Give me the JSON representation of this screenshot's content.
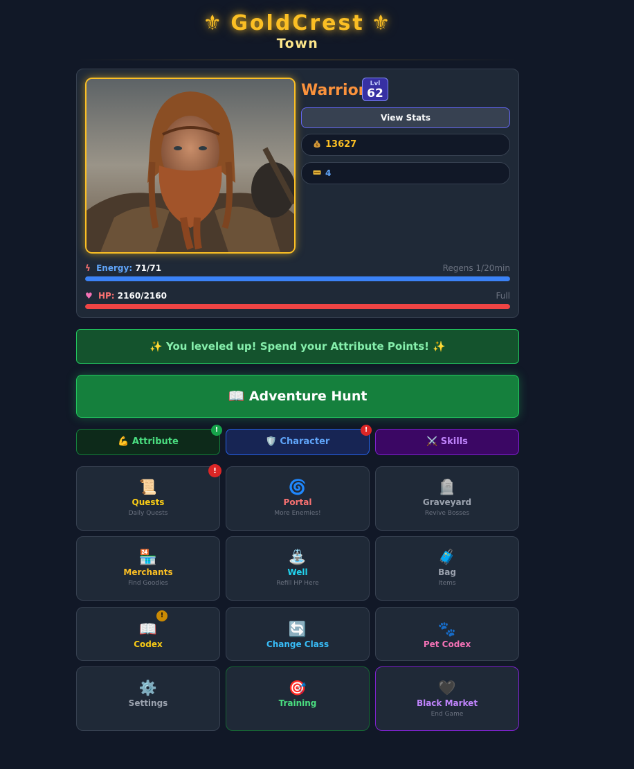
{
  "header": {
    "title": "GoldCrest",
    "fleur": "⚜",
    "subtitle": "Town"
  },
  "character": {
    "class_name": "Warrior",
    "level_label": "Lvl",
    "level": "62",
    "view_stats_label": "View Stats",
    "gold": "13627",
    "tickets": "4",
    "energy": {
      "label": "Energy:",
      "value": "71/71",
      "note": "Regens 1/20min",
      "fill_fraction": 1.0
    },
    "hp": {
      "label": "HP:",
      "value": "2160/2160",
      "note": "Full",
      "fill_fraction": 1.0
    }
  },
  "banner": {
    "level_up": "✨ You leveled up! Spend your Attribute Points! ✨"
  },
  "hunt": {
    "label": "📖 Adventure Hunt"
  },
  "tabs": [
    {
      "icon": "💪",
      "label": "Attribute",
      "notif": "!"
    },
    {
      "icon": "🛡️",
      "label": "Character",
      "notif": "!"
    },
    {
      "icon": "⚔️",
      "label": "Skills"
    }
  ],
  "tiles": [
    {
      "icon": "📜",
      "title": "Quests",
      "sub": "Daily Quests",
      "notif": "!"
    },
    {
      "icon": "🌀",
      "title": "Portal",
      "sub": "More Enemies!"
    },
    {
      "icon": "🪦",
      "title": "Graveyard",
      "sub": "Revive Bosses"
    },
    {
      "icon": "🏪",
      "title": "Merchants",
      "sub": "Find Goodies"
    },
    {
      "icon": "⛲",
      "title": "Well",
      "sub": "Refill HP Here"
    },
    {
      "icon": "🧳",
      "title": "Bag",
      "sub": "Items"
    },
    {
      "icon": "📖",
      "title": "Codex",
      "notif": "!"
    },
    {
      "icon": "🔄",
      "title": "Change Class"
    },
    {
      "icon": "🐾",
      "title": "Pet Codex"
    },
    {
      "icon": "⚙️",
      "title": "Settings"
    },
    {
      "icon": "🎯",
      "title": "Training"
    },
    {
      "icon": "🖤",
      "title": "Black Market",
      "sub": "End Game"
    }
  ],
  "colors": {
    "gold": "#fbbf24",
    "energy_bar": "#3b82f6",
    "hp_bar": "#ef4444",
    "class_name": "#fb923c",
    "level_up_green": "#86efac"
  }
}
